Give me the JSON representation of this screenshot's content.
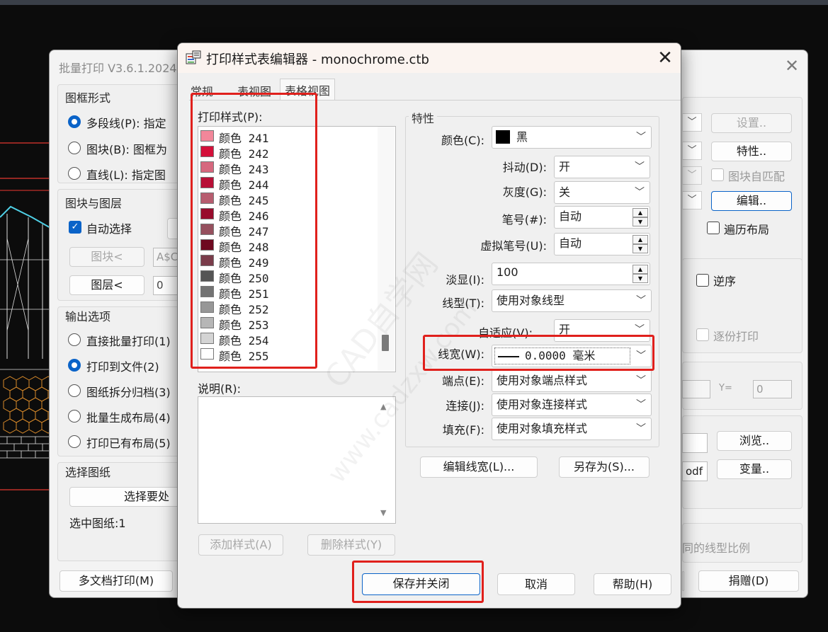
{
  "back_window": {
    "title": "批量打印 V3.6.1.2024",
    "sections": {
      "frame_type": "图框形式",
      "block_layer": "图块与图层",
      "output": "输出选项",
      "select_sheets": "选择图纸"
    },
    "frame_options": [
      "多段线(P): 指定",
      "图块(B): 图框为",
      "直线(L): 指定图"
    ],
    "auto_select": "自动选择",
    "block_btn": "图块<",
    "block_value": "A$C",
    "layer_btn": "图层<",
    "layer_value": "0",
    "output_options": [
      "直接批量打印(1)",
      "打印到文件(2)",
      "图纸拆分归档(3)",
      "批量生成布局(4)",
      "打印已有布局(5)"
    ],
    "select_btn": "选择要处",
    "selected_count": "选中图纸:1",
    "multi_doc_btn": "多文档打印(M)",
    "settings_btn": "设置..",
    "props_btn": "特性..",
    "block_auto_match": "图块自匹配",
    "edit_btn": "编辑..",
    "traverse_layout": "遍历布局",
    "reverse": "逆序",
    "print_by_copy": "逐份打印",
    "y_label": "Y=",
    "y_value": "0",
    "browse_btn": "浏览..",
    "pdf_label": "odf",
    "variables_btn": "变量..",
    "linetype_scale_text": "同的线型比例",
    "donate_btn": "捐赠(D)"
  },
  "dialog": {
    "title": "打印样式表编辑器 - monochrome.ctb",
    "tabs": [
      "常规",
      "表视图",
      "表格视图"
    ],
    "active_tab": 2,
    "print_style_label": "打印样式(P):",
    "styles": [
      {
        "name": "颜色 241",
        "color": "#f2879a"
      },
      {
        "name": "颜色 242",
        "color": "#d4103a"
      },
      {
        "name": "颜色 243",
        "color": "#d6687e"
      },
      {
        "name": "颜色 244",
        "color": "#b80f36"
      },
      {
        "name": "颜色 245",
        "color": "#b75d6f"
      },
      {
        "name": "颜色 246",
        "color": "#980c2c"
      },
      {
        "name": "颜色 247",
        "color": "#96505e"
      },
      {
        "name": "颜色 248",
        "color": "#6e0920"
      },
      {
        "name": "颜色 249",
        "color": "#7a3c4a"
      },
      {
        "name": "颜色 250",
        "color": "#555555"
      },
      {
        "name": "颜色 251",
        "color": "#737373"
      },
      {
        "name": "颜色 252",
        "color": "#979797"
      },
      {
        "name": "颜色 253",
        "color": "#b6b6b6"
      },
      {
        "name": "颜色 254",
        "color": "#d4d4d4"
      },
      {
        "name": "颜色 255",
        "color": "#ffffff"
      }
    ],
    "description_label": "说明(R):",
    "add_style_btn": "添加样式(A)",
    "delete_style_btn": "删除样式(Y)",
    "properties_label": "特性",
    "color_label": "颜色(C):",
    "color_value": "黑",
    "color_swatch": "#000000",
    "dither_label": "抖动(D):",
    "dither_value": "开",
    "grayscale_label": "灰度(G):",
    "grayscale_value": "关",
    "pen_label": "笔号(#):",
    "pen_value": "自动",
    "virtual_pen_label": "虚拟笔号(U):",
    "virtual_pen_value": "自动",
    "screening_label": "淡显(I):",
    "screening_value": "100",
    "linetype_label": "线型(T):",
    "linetype_value": "使用对象线型",
    "adaptive_label": "自适应(V):",
    "adaptive_value": "开",
    "lineweight_label": "线宽(W):",
    "lineweight_value": "0.0000 毫米",
    "endstyle_label": "端点(E):",
    "endstyle_value": "使用对象端点样式",
    "joinstyle_label": "连接(J):",
    "joinstyle_value": "使用对象连接样式",
    "fill_label": "填充(F):",
    "fill_value": "使用对象填充样式",
    "edit_lineweight_btn": "编辑线宽(L)...",
    "save_as_btn": "另存为(S)...",
    "save_close_btn": "保存并关闭",
    "cancel_btn": "取消",
    "help_btn": "帮助(H)"
  },
  "watermark": {
    "line1": "CAD自学网",
    "line2": "www.cadzxw.com"
  },
  "highlight_color": "#e0201c",
  "accent_color": "#0a63c8"
}
